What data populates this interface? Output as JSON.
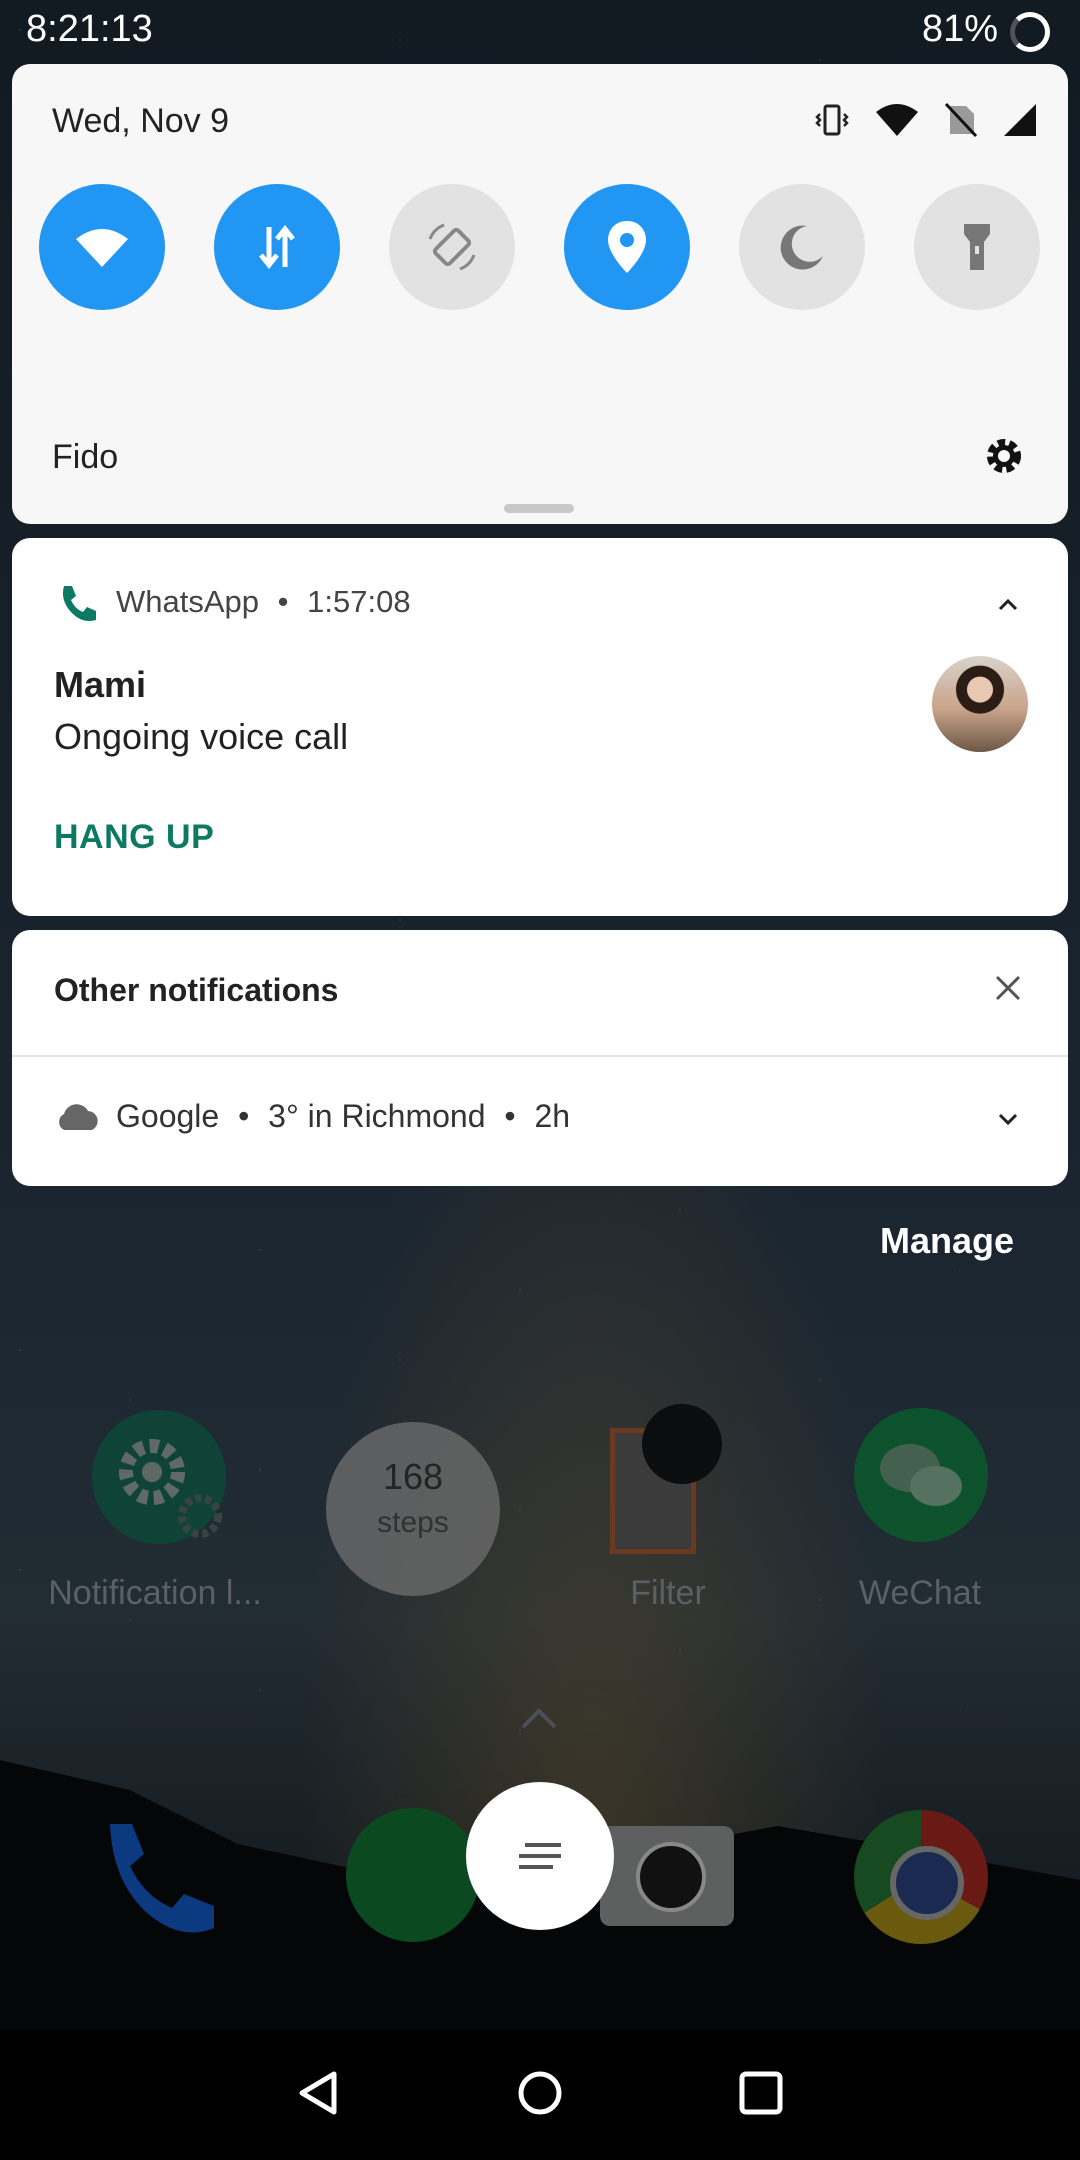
{
  "status_bar": {
    "time": "8:21:13",
    "battery_percent": "81%"
  },
  "quick_settings": {
    "date": "Wed, Nov 9",
    "carrier": "Fido",
    "tiles": [
      {
        "name": "wifi",
        "state": "on"
      },
      {
        "name": "mobile-data",
        "state": "on"
      },
      {
        "name": "auto-rotate",
        "state": "off"
      },
      {
        "name": "location",
        "state": "on"
      },
      {
        "name": "night-mode",
        "state": "off"
      },
      {
        "name": "flashlight",
        "state": "off"
      }
    ]
  },
  "whatsapp_notification": {
    "app": "WhatsApp",
    "separator": "•",
    "elapsed": "1:57:08",
    "caller": "Mami",
    "status": "Ongoing voice call",
    "action": "HANG UP"
  },
  "other_notifications": {
    "title": "Other notifications",
    "google": {
      "app": "Google",
      "separator": "•",
      "summary": "3° in Richmond",
      "time": "2h"
    }
  },
  "manage_label": "Manage",
  "home_apps": {
    "notification_app": "Notification l...",
    "steps_count": "168",
    "steps_label": "steps",
    "filter": "Filter",
    "wechat": "WeChat"
  },
  "colors": {
    "accent_blue": "#2196f3",
    "whatsapp_green": "#0c7a63",
    "tile_off": "#e2e2e2"
  }
}
